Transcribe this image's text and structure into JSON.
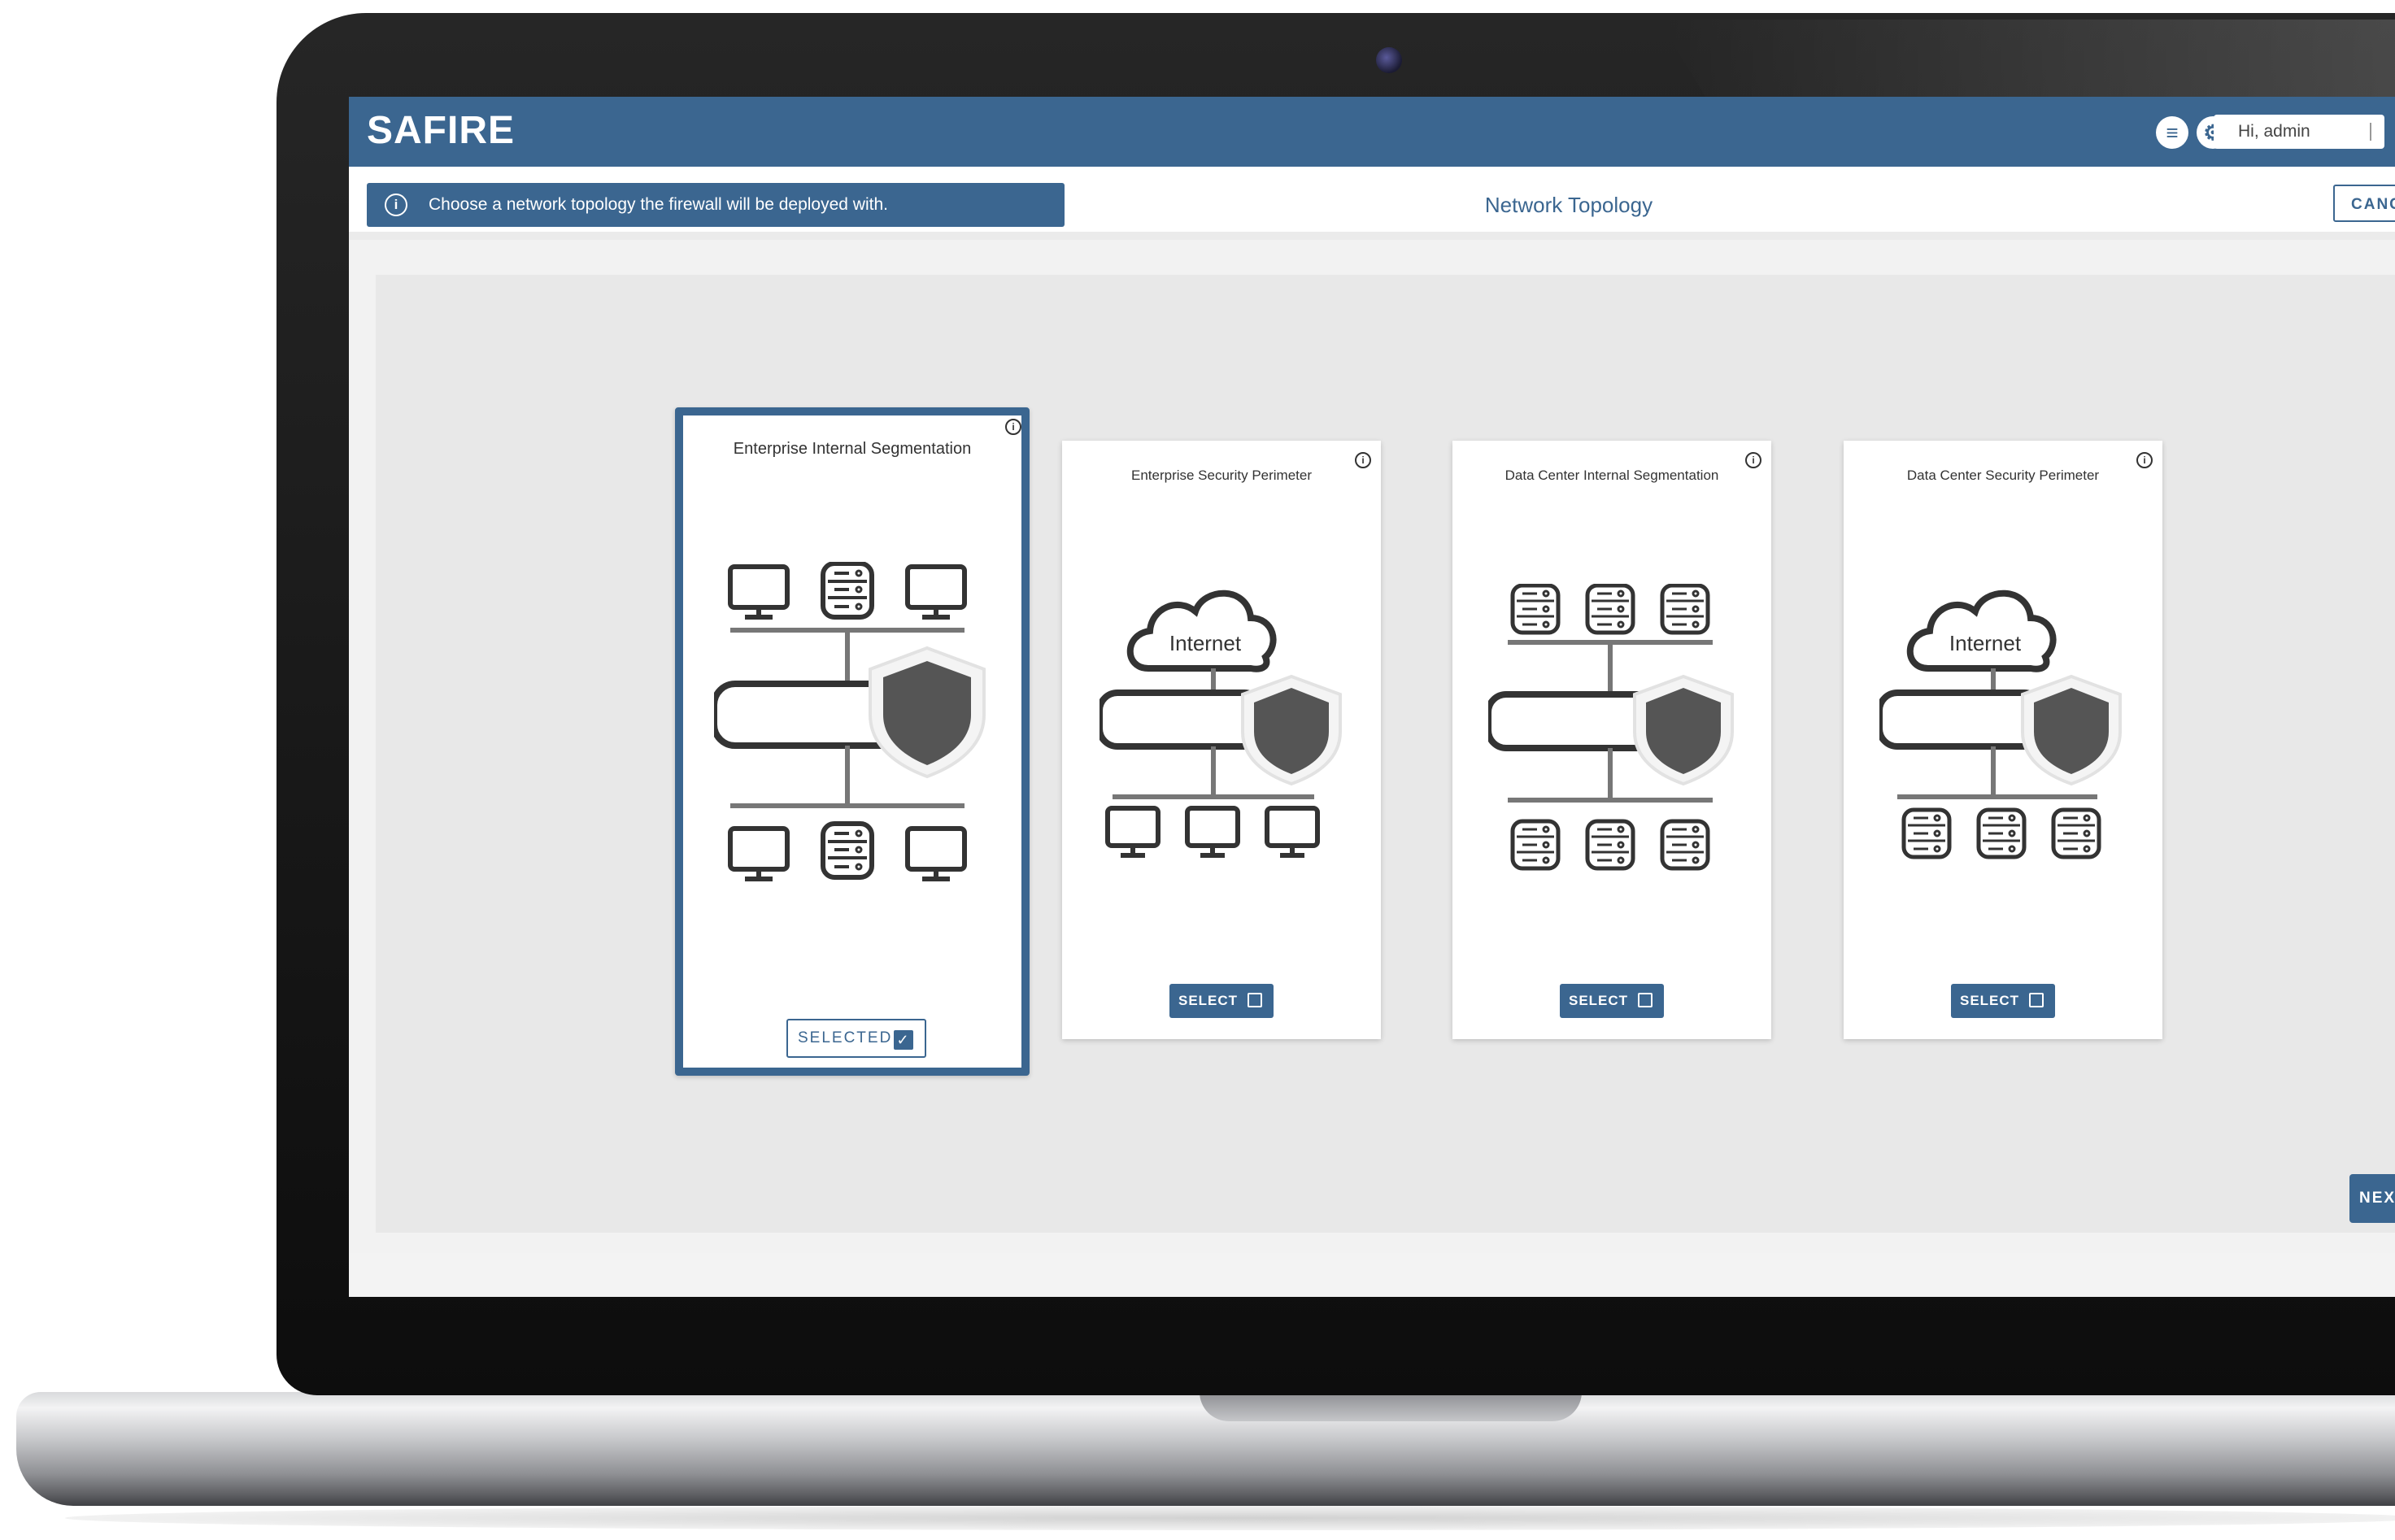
{
  "app": {
    "logo": "SAFIRE"
  },
  "header": {
    "menu_icon": "menu-icon",
    "settings_icon": "gear-icon",
    "greeting": "Hi, admin"
  },
  "subbar": {
    "info_text": "Choose a network topology the firewall will be deployed with.",
    "page_title": "Network Topology",
    "cancel_label": "CANC"
  },
  "cards": [
    {
      "title": "Enterprise Internal Segmentation",
      "button_label": "SELECTED",
      "selected": true,
      "diagram": "internal-segmentation",
      "devices": "computers"
    },
    {
      "title": "Enterprise Security Perimeter",
      "button_label": "SELECT",
      "selected": false,
      "diagram": "security-perimeter",
      "devices": "computers",
      "cloud_label": "Internet"
    },
    {
      "title": "Data Center Internal Segmentation",
      "button_label": "SELECT",
      "selected": false,
      "diagram": "internal-segmentation",
      "devices": "servers"
    },
    {
      "title": "Data Center Security Perimeter",
      "button_label": "SELECT",
      "selected": false,
      "diagram": "security-perimeter",
      "devices": "servers",
      "cloud_label": "Internet"
    }
  ],
  "footer": {
    "next_label": "NEXT"
  },
  "colors": {
    "primary": "#3b6690",
    "content_bg": "#e8e8e8",
    "icon_dark": "#333333",
    "shield": "#555555"
  }
}
